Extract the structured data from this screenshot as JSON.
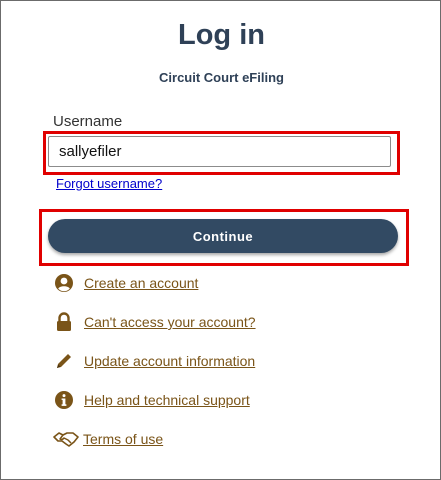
{
  "header": {
    "title": "Log in",
    "subtitle": "Circuit Court eFiling"
  },
  "form": {
    "username_label": "Username",
    "username_value": "sallyefiler",
    "forgot_username": "Forgot username?",
    "continue_label": "Continue"
  },
  "links": [
    {
      "icon": "user-circle-icon",
      "label": "Create an account"
    },
    {
      "icon": "lock-icon",
      "label": "Can't access your account?"
    },
    {
      "icon": "pencil-icon",
      "label": "Update account information"
    },
    {
      "icon": "info-icon",
      "label": "Help and technical support"
    },
    {
      "icon": "handshake-icon",
      "label": "Terms of use"
    }
  ],
  "colors": {
    "heading": "#2f4157",
    "button": "#324a63",
    "link_brown": "#7a5418",
    "link_blue": "#0000cc",
    "highlight": "#e00000"
  }
}
